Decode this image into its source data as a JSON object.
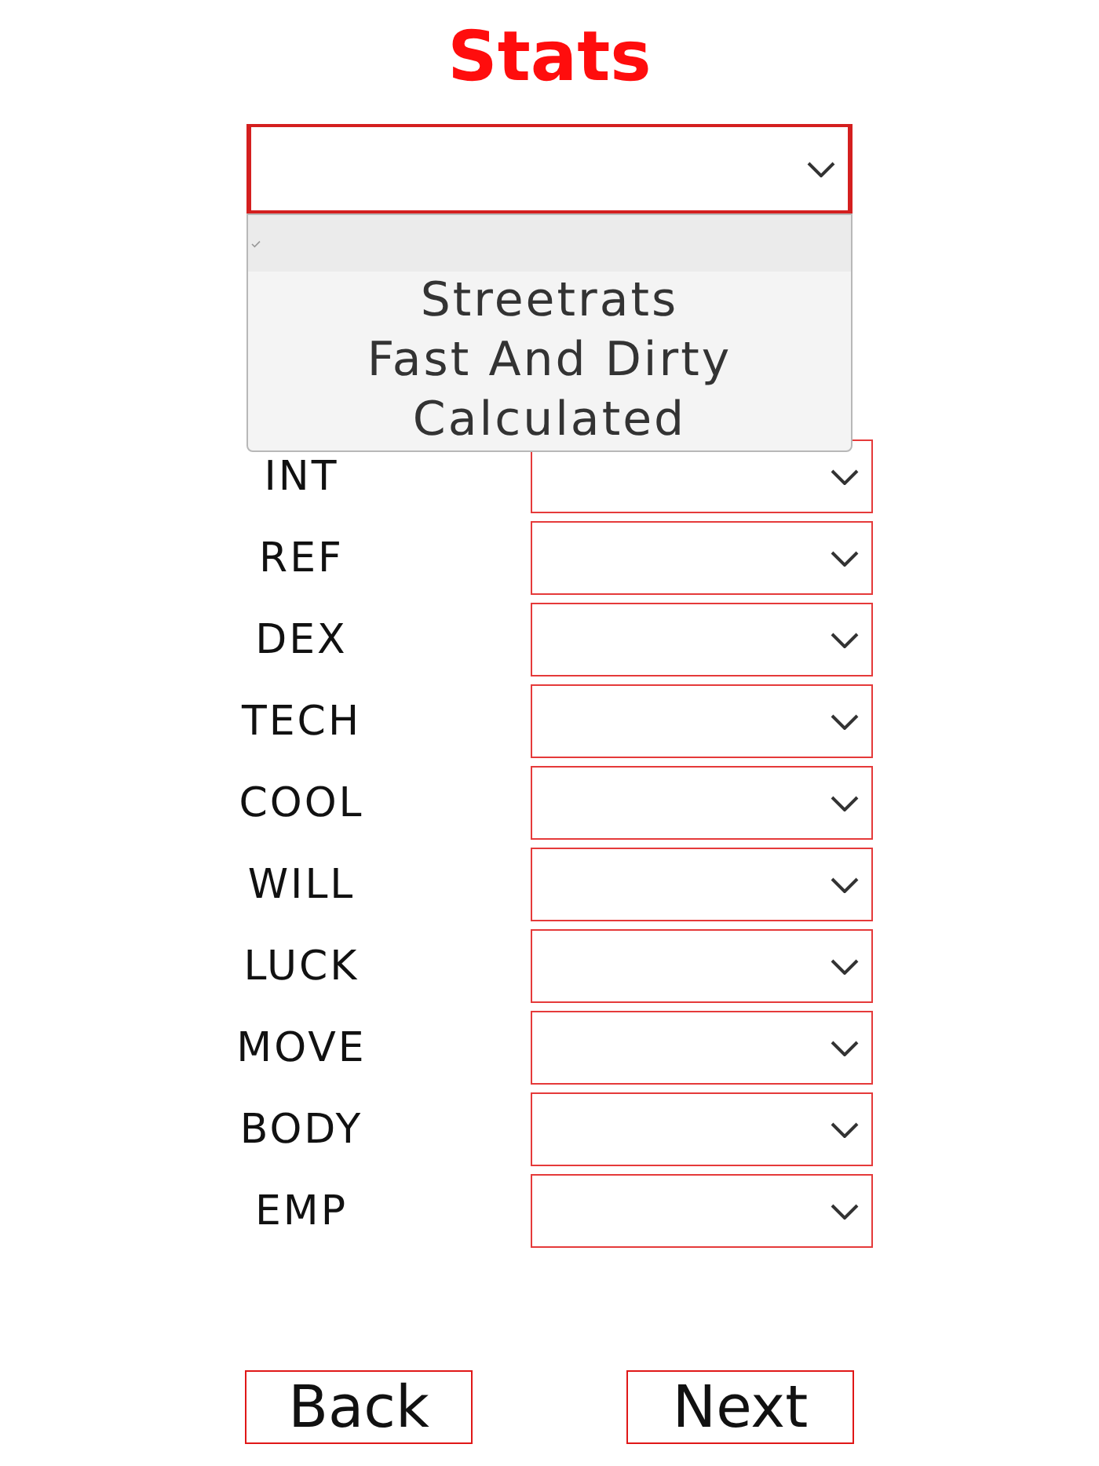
{
  "title": "Stats",
  "preset_select": {
    "focused": true,
    "expanded": true,
    "options": [
      {
        "selected": true
      },
      {
        "label": "Streetrats",
        "selected": false
      },
      {
        "label": "Fast And Dirty",
        "selected": false
      },
      {
        "label": "Calculated",
        "selected": false
      }
    ]
  },
  "table": {
    "rows": [
      {
        "stat": "INT"
      },
      {
        "stat": "REF"
      },
      {
        "stat": "DEX"
      },
      {
        "stat": "TECH"
      },
      {
        "stat": "COOL"
      },
      {
        "stat": "WILL"
      },
      {
        "stat": "LUCK"
      },
      {
        "stat": "MOVE"
      },
      {
        "stat": "BODY"
      },
      {
        "stat": "EMP"
      }
    ]
  },
  "buttons": [
    "Back",
    "Next"
  ]
}
